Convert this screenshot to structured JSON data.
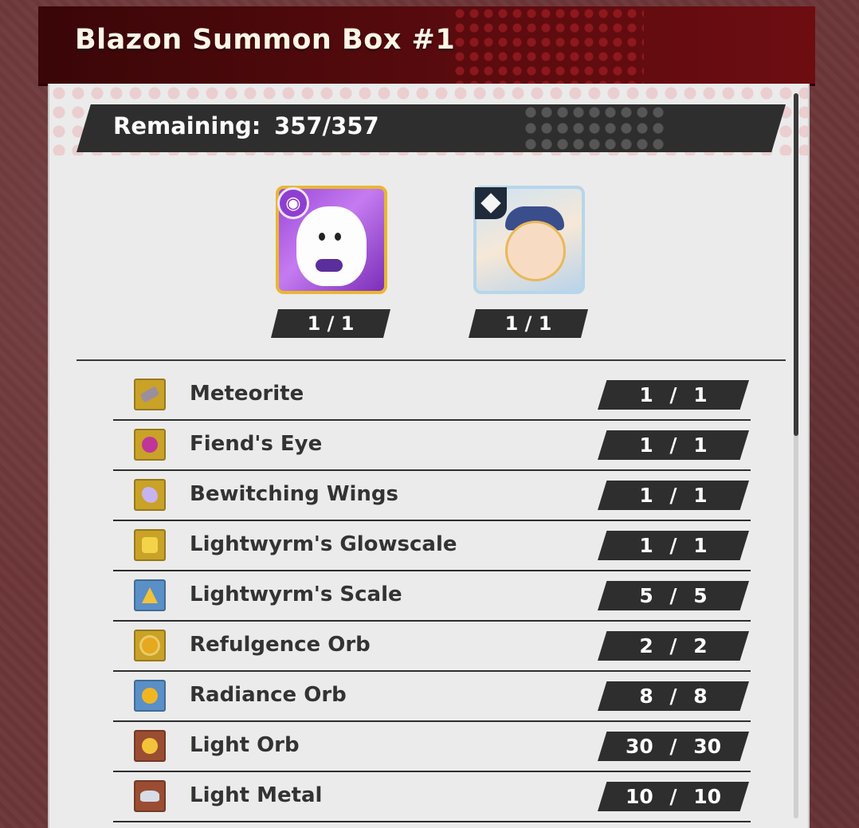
{
  "window": {
    "title": "Blazon Summon Box #1"
  },
  "remaining": {
    "label": "Remaining:",
    "value": "357/357"
  },
  "featured_rewards": [
    {
      "icon": "ghost-wyrmprint-icon",
      "badge": "purple-swirl-badge-icon",
      "count": "1 / 1"
    },
    {
      "icon": "winter-girl-wyrmprint-icon",
      "badge": "diamond-badge-icon",
      "count": "1 / 1"
    }
  ],
  "items": [
    {
      "name": "Meteorite",
      "count": "1 / 1",
      "icon": "meteorite-icon",
      "icon_bg": "#c9a227",
      "glyph_color": "#9b8f9d"
    },
    {
      "name": "Fiend's Eye",
      "count": "1 / 1",
      "icon": "fiends-eye-icon",
      "icon_bg": "#c9a227",
      "glyph_color": "#c0359a"
    },
    {
      "name": "Bewitching Wings",
      "count": "1 / 1",
      "icon": "bewitching-wings-icon",
      "icon_bg": "#c9a227",
      "glyph_color": "#c7b3f0"
    },
    {
      "name": "Lightwyrm's Glowscale",
      "count": "1 / 1",
      "icon": "lightwyrm-glowscale-icon",
      "icon_bg": "#c9a227",
      "glyph_color": "#f3d34a"
    },
    {
      "name": "Lightwyrm's Scale",
      "count": "5 / 5",
      "icon": "lightwyrm-scale-icon",
      "icon_bg": "#5a8fc7",
      "glyph_color": "#f2c23a"
    },
    {
      "name": "Refulgence Orb",
      "count": "2 / 2",
      "icon": "refulgence-orb-icon",
      "icon_bg": "#c9a227",
      "glyph_color": "#e6a81f"
    },
    {
      "name": "Radiance Orb",
      "count": "8 / 8",
      "icon": "radiance-orb-icon",
      "icon_bg": "#5a8fc7",
      "glyph_color": "#f0b622"
    },
    {
      "name": "Light Orb",
      "count": "30 / 30",
      "icon": "light-orb-icon",
      "icon_bg": "#9a4d33",
      "glyph_color": "#f3c43a"
    },
    {
      "name": "Light Metal",
      "count": "10 / 10",
      "icon": "light-metal-icon",
      "icon_bg": "#9a4d33",
      "glyph_color": "#d6dde6"
    }
  ],
  "colors": {
    "title_bar": "#4a0709",
    "panel": "#ebebeb",
    "tag_dark": "#2e2e2e"
  }
}
